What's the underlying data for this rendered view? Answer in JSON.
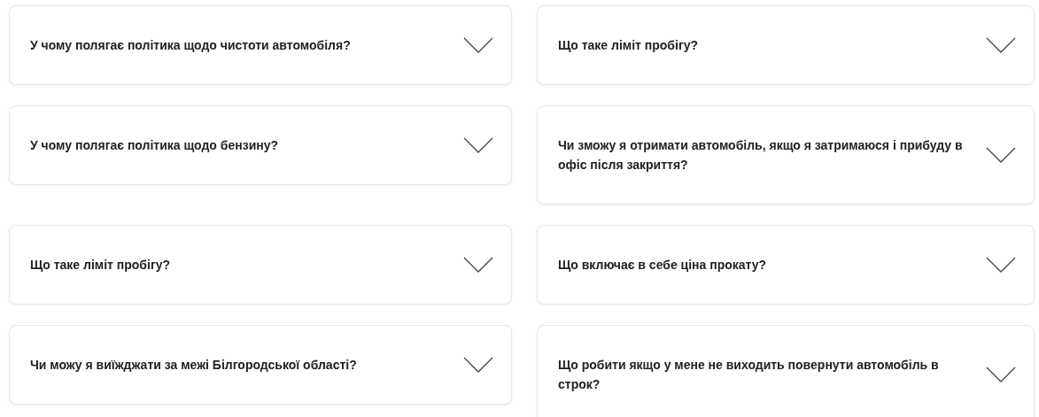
{
  "faq": [
    {
      "question": "У чому полягає політика щодо чистоти автомобіля?",
      "expanded": false
    },
    {
      "question": "Що таке ліміт пробігу?",
      "expanded": false
    },
    {
      "question": "У чому полягає політика щодо бензину?",
      "expanded": false
    },
    {
      "question": "Чи зможу я отримати автомобіль, якщо я затримаюся і прибуду в офіс після закриття?",
      "expanded": false
    },
    {
      "question": "Що таке ліміт пробігу?",
      "expanded": false
    },
    {
      "question": "Що включає в себе ціна прокату?",
      "expanded": false
    },
    {
      "question": "Чи можу я виїжджати за межі Білгородської області?",
      "expanded": false
    },
    {
      "question": "Що робити якщо у мене не виходить повернути автомобіль в строк?",
      "expanded": false
    }
  ]
}
